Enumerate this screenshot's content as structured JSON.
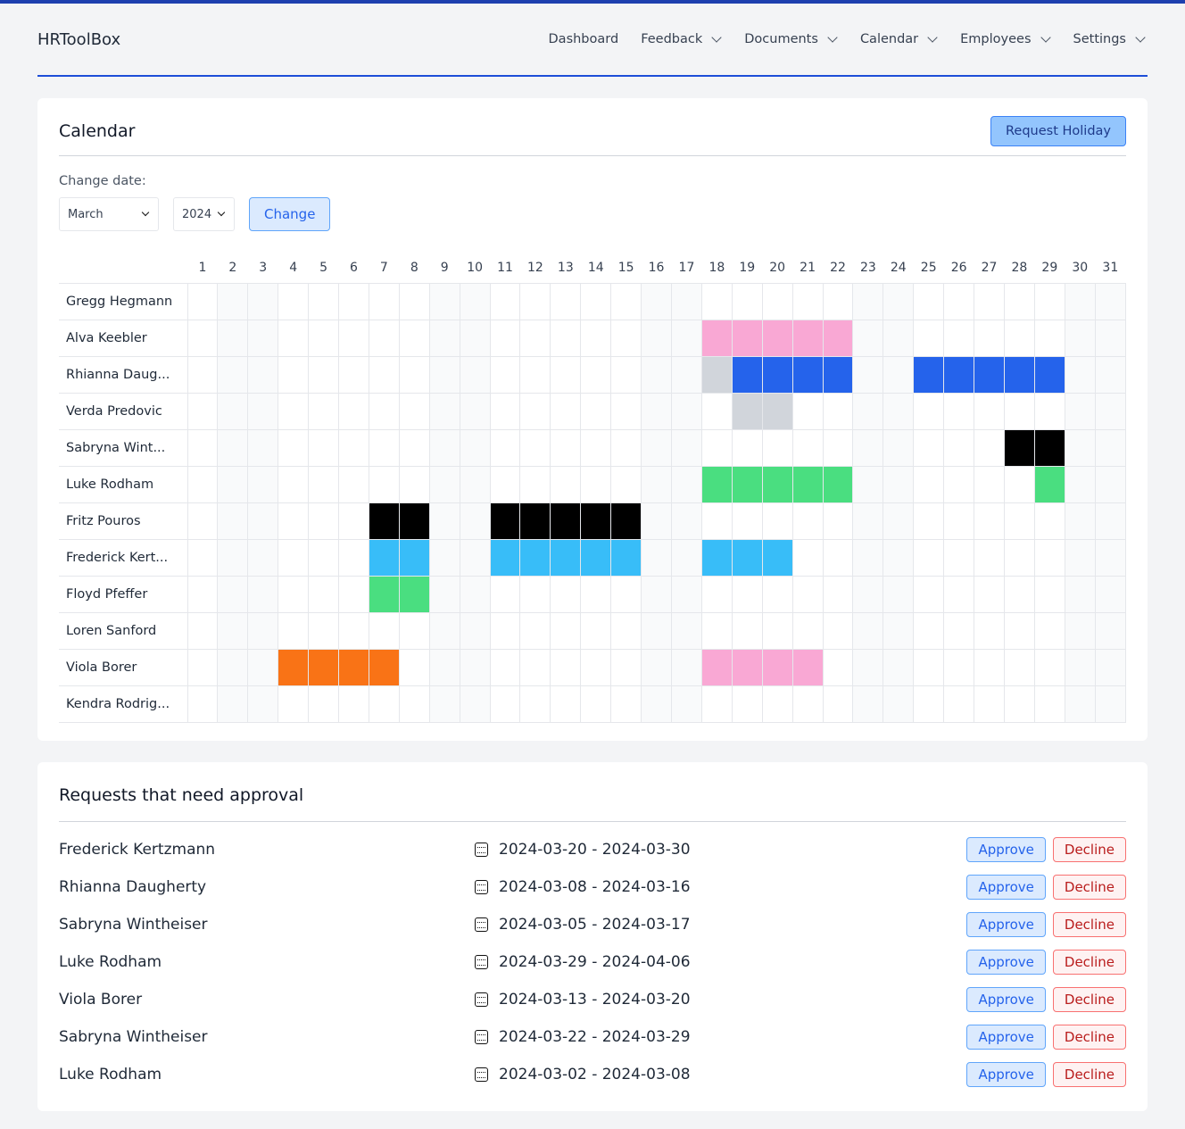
{
  "app": {
    "brand": "HRToolBox"
  },
  "nav": [
    {
      "label": "Dashboard",
      "dropdown": false
    },
    {
      "label": "Feedback",
      "dropdown": true
    },
    {
      "label": "Documents",
      "dropdown": true
    },
    {
      "label": "Calendar",
      "dropdown": true
    },
    {
      "label": "Employees",
      "dropdown": true
    },
    {
      "label": "Settings",
      "dropdown": true
    }
  ],
  "calendar": {
    "title": "Calendar",
    "request_label": "Request Holiday",
    "change_date_label": "Change date:",
    "month": "March",
    "year": "2024",
    "change_label": "Change",
    "days": 31,
    "weekend_days": [
      2,
      3,
      9,
      10,
      16,
      17,
      23,
      24,
      30,
      31
    ],
    "colors": {
      "pink": "#f9a8d4",
      "gray": "#d1d5db",
      "blue": "#2563eb",
      "black": "#000000",
      "green": "#4ade80",
      "sky": "#38bdf8",
      "orange": "#f97316"
    },
    "rows": [
      {
        "name": "Gregg Hegmann",
        "marks": []
      },
      {
        "name": "Alva Keebler",
        "marks": [
          {
            "days": [
              18,
              19,
              20,
              21,
              22
            ],
            "color": "pink"
          }
        ]
      },
      {
        "name": "Rhianna Daug...",
        "marks": [
          {
            "days": [
              18
            ],
            "color": "gray"
          },
          {
            "days": [
              19,
              20,
              21,
              22,
              25,
              26,
              27,
              28,
              29
            ],
            "color": "blue"
          }
        ]
      },
      {
        "name": "Verda Predovic",
        "marks": [
          {
            "days": [
              19,
              20
            ],
            "color": "gray"
          }
        ]
      },
      {
        "name": "Sabryna Wint...",
        "marks": [
          {
            "days": [
              28,
              29
            ],
            "color": "black"
          }
        ]
      },
      {
        "name": "Luke Rodham",
        "marks": [
          {
            "days": [
              18,
              19,
              20,
              21,
              22,
              29
            ],
            "color": "green"
          }
        ]
      },
      {
        "name": "Fritz Pouros",
        "marks": [
          {
            "days": [
              7,
              8,
              11,
              12,
              13,
              14,
              15
            ],
            "color": "black"
          }
        ]
      },
      {
        "name": "Frederick Kert...",
        "marks": [
          {
            "days": [
              7,
              8,
              11,
              12,
              13,
              14,
              15,
              18,
              19,
              20
            ],
            "color": "sky"
          }
        ]
      },
      {
        "name": "Floyd Pfeffer",
        "marks": [
          {
            "days": [
              7,
              8
            ],
            "color": "green"
          }
        ]
      },
      {
        "name": "Loren Sanford",
        "marks": []
      },
      {
        "name": "Viola Borer",
        "marks": [
          {
            "days": [
              4,
              5,
              6,
              7
            ],
            "color": "orange"
          },
          {
            "days": [
              18,
              19,
              20,
              21
            ],
            "color": "pink"
          }
        ]
      },
      {
        "name": "Kendra Rodrig...",
        "marks": []
      }
    ]
  },
  "requests": {
    "title": "Requests that need approval",
    "approve_label": "Approve",
    "decline_label": "Decline",
    "items": [
      {
        "name": "Frederick Kertzmann",
        "range": "2024-03-20 - 2024-03-30"
      },
      {
        "name": "Rhianna Daugherty",
        "range": "2024-03-08 - 2024-03-16"
      },
      {
        "name": "Sabryna Wintheiser",
        "range": "2024-03-05 - 2024-03-17"
      },
      {
        "name": "Luke Rodham",
        "range": "2024-03-29 - 2024-04-06"
      },
      {
        "name": "Viola Borer",
        "range": "2024-03-13 - 2024-03-20"
      },
      {
        "name": "Sabryna Wintheiser",
        "range": "2024-03-22 - 2024-03-29"
      },
      {
        "name": "Luke Rodham",
        "range": "2024-03-02 - 2024-03-08"
      }
    ]
  }
}
